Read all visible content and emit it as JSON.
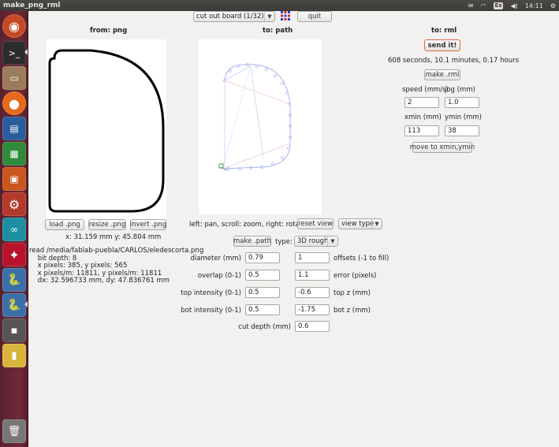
{
  "window": {
    "title": "make_png_rml",
    "clock": "14:11",
    "keyboard": "Es"
  },
  "toolbar": {
    "board_select": "cut out board (1/32)",
    "quit_label": "quit"
  },
  "png_panel": {
    "header": "from: png",
    "load_label": "load .png",
    "resize_label": "resize .png",
    "invert_label": "invert .png",
    "coords": "x: 31.159 mm  y: 45.804 mm",
    "info_lines": [
      "read /media/fablab-puebla/CARLOS/eledescorta.png",
      "    bit depth: 8",
      "    x pixels: 385, y pixels: 565",
      "    x pixels/m: 11811, y pixels/m: 11811",
      "    dx: 32.596733 mm, dy: 47.836761 mm"
    ]
  },
  "path_panel": {
    "header": "to: path",
    "hint": "left: pan, scroll: zoom, right: rotate",
    "reset_view_label": "reset view",
    "view_type": "view type",
    "make_path_label": "make .path",
    "type_label": "type:",
    "type_value": "3D rough",
    "params": [
      {
        "label": "diameter (mm)",
        "value": "0.79",
        "label2": "offsets (-1 to fill)",
        "value2": "1"
      },
      {
        "label": "overlap (0-1)",
        "value": "0.5",
        "label2": "error (pixels)",
        "value2": "1.1"
      },
      {
        "label": "top intensity (0-1)",
        "value": "0.5",
        "label2": "top z (mm)",
        "value2": "-0.6"
      },
      {
        "label": "bot intensity (0-1)",
        "value": "0.5",
        "label2": "bot z (mm)",
        "value2": "-1.75"
      }
    ],
    "cut_depth_label": "cut depth (mm)",
    "cut_depth_value": "0.6"
  },
  "rml_panel": {
    "header": "to: rml",
    "send_label": "send it!",
    "time_estimate": "608 seconds, 10.1 minutes, 0.17 hours",
    "make_rml_label": "make .rml",
    "speed_label": "speed (mm/s)",
    "speed_value": "2",
    "jog_label": "jog (mm)",
    "jog_value": "1.0",
    "xmin_label": "xmin (mm)",
    "xmin_value": "113",
    "ymin_label": "ymin (mm)",
    "ymin_value": "38",
    "move_label": "move to xmin,ymin"
  },
  "colors": {
    "accent": "#e0663f",
    "launcher": "#6f2a37",
    "path_line": "#aab4f0"
  }
}
